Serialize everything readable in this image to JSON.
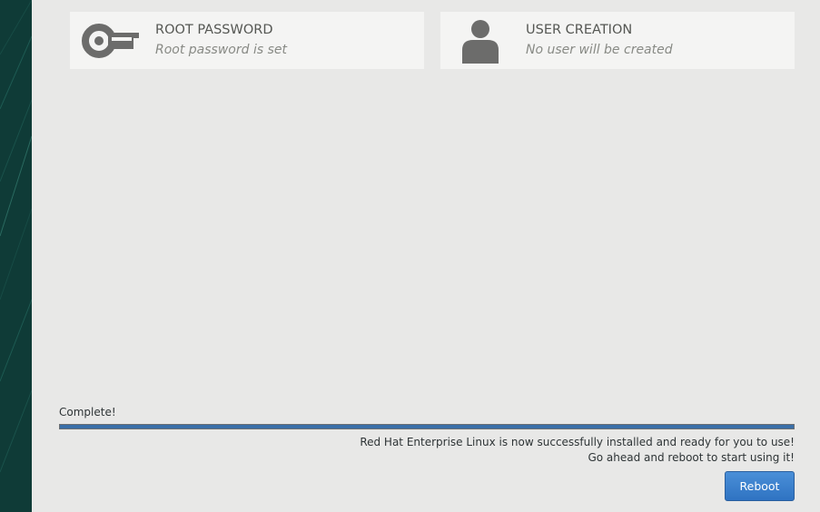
{
  "spokes": {
    "root_password": {
      "title": "ROOT PASSWORD",
      "status": "Root password is set",
      "icon": "key-icon"
    },
    "user_creation": {
      "title": "USER CREATION",
      "status": "No user will be created",
      "icon": "user-icon"
    }
  },
  "progress": {
    "label": "Complete!",
    "value": 1.0
  },
  "message": {
    "line1": "Red Hat Enterprise Linux is now successfully installed and ready for you to use!",
    "line2": "Go ahead and reboot to start using it!"
  },
  "actions": {
    "reboot_label": "Reboot"
  },
  "colors": {
    "sidebar": "#0f3b37",
    "background": "#e8e8e7",
    "progress_fill": "#3a6fa8",
    "button": "#3b82cf"
  }
}
